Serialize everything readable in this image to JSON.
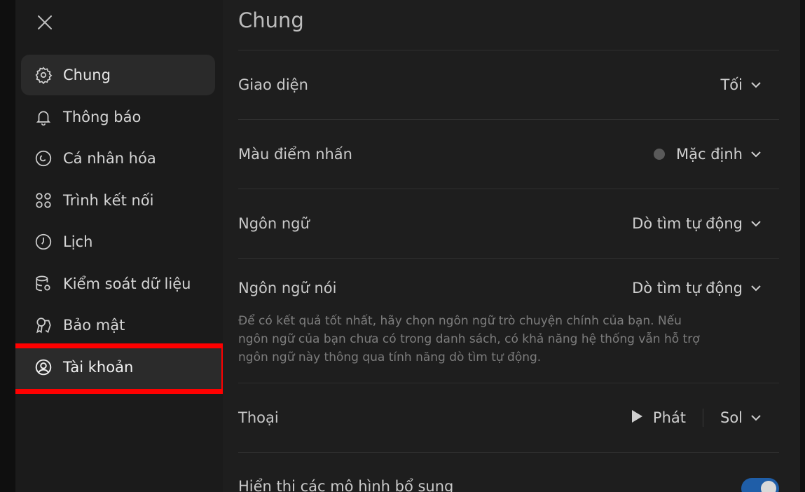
{
  "sidebar": {
    "close_label": "",
    "items": [
      {
        "label": "Chung",
        "icon": "gear-icon"
      },
      {
        "label": "Thông báo",
        "icon": "bell-icon"
      },
      {
        "label": "Cá nhân hóa",
        "icon": "personalize-icon"
      },
      {
        "label": "Trình kết nối",
        "icon": "connectors-icon"
      },
      {
        "label": "Lịch",
        "icon": "clock-icon"
      },
      {
        "label": "Kiểm soát dữ liệu",
        "icon": "database-gear-icon"
      },
      {
        "label": "Bảo mật",
        "icon": "security-icon"
      },
      {
        "label": "Tài khoản",
        "icon": "user-circle-icon"
      }
    ]
  },
  "main": {
    "title": "Chung",
    "rows": {
      "theme": {
        "label": "Giao diện",
        "value": "Tối"
      },
      "accent": {
        "label": "Màu điểm nhấn",
        "value": "Mặc định"
      },
      "language": {
        "label": "Ngôn ngữ",
        "value": "Dò tìm tự động"
      },
      "spoken": {
        "label": "Ngôn ngữ nói",
        "value": "Dò tìm tự động",
        "description": "Để có kết quả tốt nhất, hãy chọn ngôn ngữ trò chuyện chính của bạn. Nếu ngôn ngữ của bạn chưa có trong danh sách, có khả năng hệ thống vẫn hỗ trợ ngôn ngữ này thông qua tính năng dò tìm tự động."
      },
      "voice": {
        "label": "Thoại",
        "play_label": "Phát",
        "value": "Sol"
      },
      "additional_models": {
        "label": "Hiển thị các mô hình bổ sung",
        "enabled": true
      }
    }
  },
  "colors": {
    "accent_toggle": "#1f5ea8",
    "highlight": "#ff0000",
    "accent_dot": "#5a5a5a"
  }
}
